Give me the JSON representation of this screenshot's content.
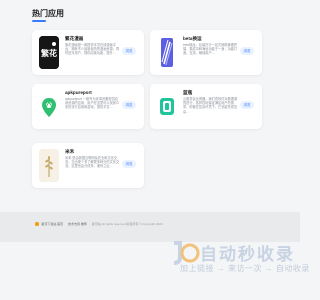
{
  "section": {
    "title": "热门应用"
  },
  "apps": [
    {
      "name": "繁花漫画",
      "desc": "繁花漫画是一款提供丰富在线漫画平台，拥有不少最新最热的漫画资源，同时还可用户，提供阅读功能，提升…",
      "button": "浏览",
      "icon": "fanhua-logo-icon",
      "logo_text": "繁花"
    },
    {
      "name": "beta换运",
      "desc": "beta换运，包装在行一站式网络管理终端，集成中转海运功能于一身，功能打造。支持，确保用户…",
      "button": "浏览",
      "icon": "beta-striped-logo-icon"
    },
    {
      "name": "apkpureport",
      "desc": "apkpureport 一款专为安卓设备提供应用资源的应用，用户在这里可以找到众多的流行应用和游戏，提供丰富…",
      "button": "浏览",
      "icon": "location-pin-logo-icon"
    },
    {
      "name": "蓝瓶",
      "desc": "云服务会比得器，我们查找件对数据源的进行，各样性地保证满足用户的需求，即使在复杂环境下，它也能完成复杂…",
      "button": "浏览",
      "icon": "green-cup-logo-icon"
    },
    {
      "name": "米禾",
      "desc": "米禾 是由我国互联网及农业和文化交流，交出现个多了解更多种分的文化交流，这里也会分成多，便你之后…",
      "button": "浏览",
      "icon": "wheat-logo-icon"
    }
  ],
  "footer": {
    "links": [
      "星河下载站 首页",
      "技术支持 推荐"
    ],
    "copyright": "星河站 All rights reserved 版权所有 © Copyright 2024"
  },
  "watermark": {
    "title": "自动秒收录",
    "subtitle": "加上链接 → 来访一次 → 自动收录"
  },
  "colors": {
    "accent": "#3a7bfd",
    "button_bg": "#eaf2ff"
  }
}
